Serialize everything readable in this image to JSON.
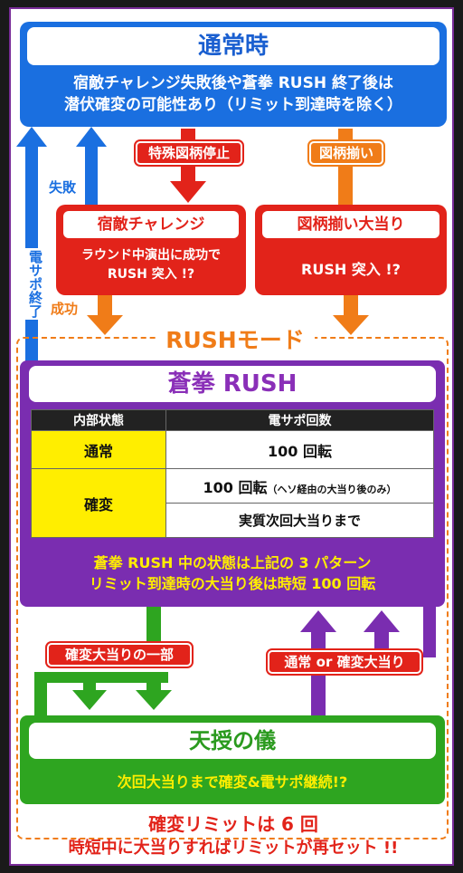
{
  "normal": {
    "title": "通常時",
    "desc_line1": "宿敵チャレンジ失敗後や蒼拳 RUSH 終了後は",
    "desc_line2": "潜伏確変の可能性あり（リミット到達時を除く）"
  },
  "labels": {
    "special_stop": "特殊図柄停止",
    "pattern_match": "図柄揃い",
    "fail": "失敗",
    "success": "成功",
    "densapo_end": "電サポ終了"
  },
  "challenge": {
    "title": "宿敵チャレンジ",
    "line1": "ラウンド中演出に成功で",
    "line2": "RUSH 突入 !?"
  },
  "jackpot": {
    "title": "図柄揃い大当り",
    "line1": "RUSH 突入 !?"
  },
  "rush_mode": "RUSHモード",
  "rush": {
    "title": "蒼拳 RUSH",
    "headers": [
      "内部状態",
      "電サポ回数"
    ],
    "row_normal": {
      "state": "通常",
      "value": "100 回転"
    },
    "row_kakuhen": {
      "state": "確変",
      "value1": "100 回転",
      "value1_note": "（ヘソ経由の大当り後のみ）",
      "value2": "実質次回大当りまで"
    },
    "foot1": "蒼拳 RUSH 中の状態は上記の 3 パターン",
    "foot2": "リミット到達時の大当り後は時短 100 回転"
  },
  "arrows_mid": {
    "left_label": "確変大当りの一部",
    "right_label": "通常 or 確変大当り"
  },
  "tenju": {
    "title": "天授の儀",
    "desc": "次回大当りまで確変&電サポ継続!?"
  },
  "footer": {
    "line1": "確変リミットは 6 回",
    "line2": "時短中に大当りすればリミットが再セット !!"
  },
  "colors": {
    "blue": "#1a6fe0",
    "red": "#e2231a",
    "orange": "#f07c18",
    "purple": "#7a2db0",
    "green": "#2ea520",
    "yellow": "#ffee00"
  }
}
